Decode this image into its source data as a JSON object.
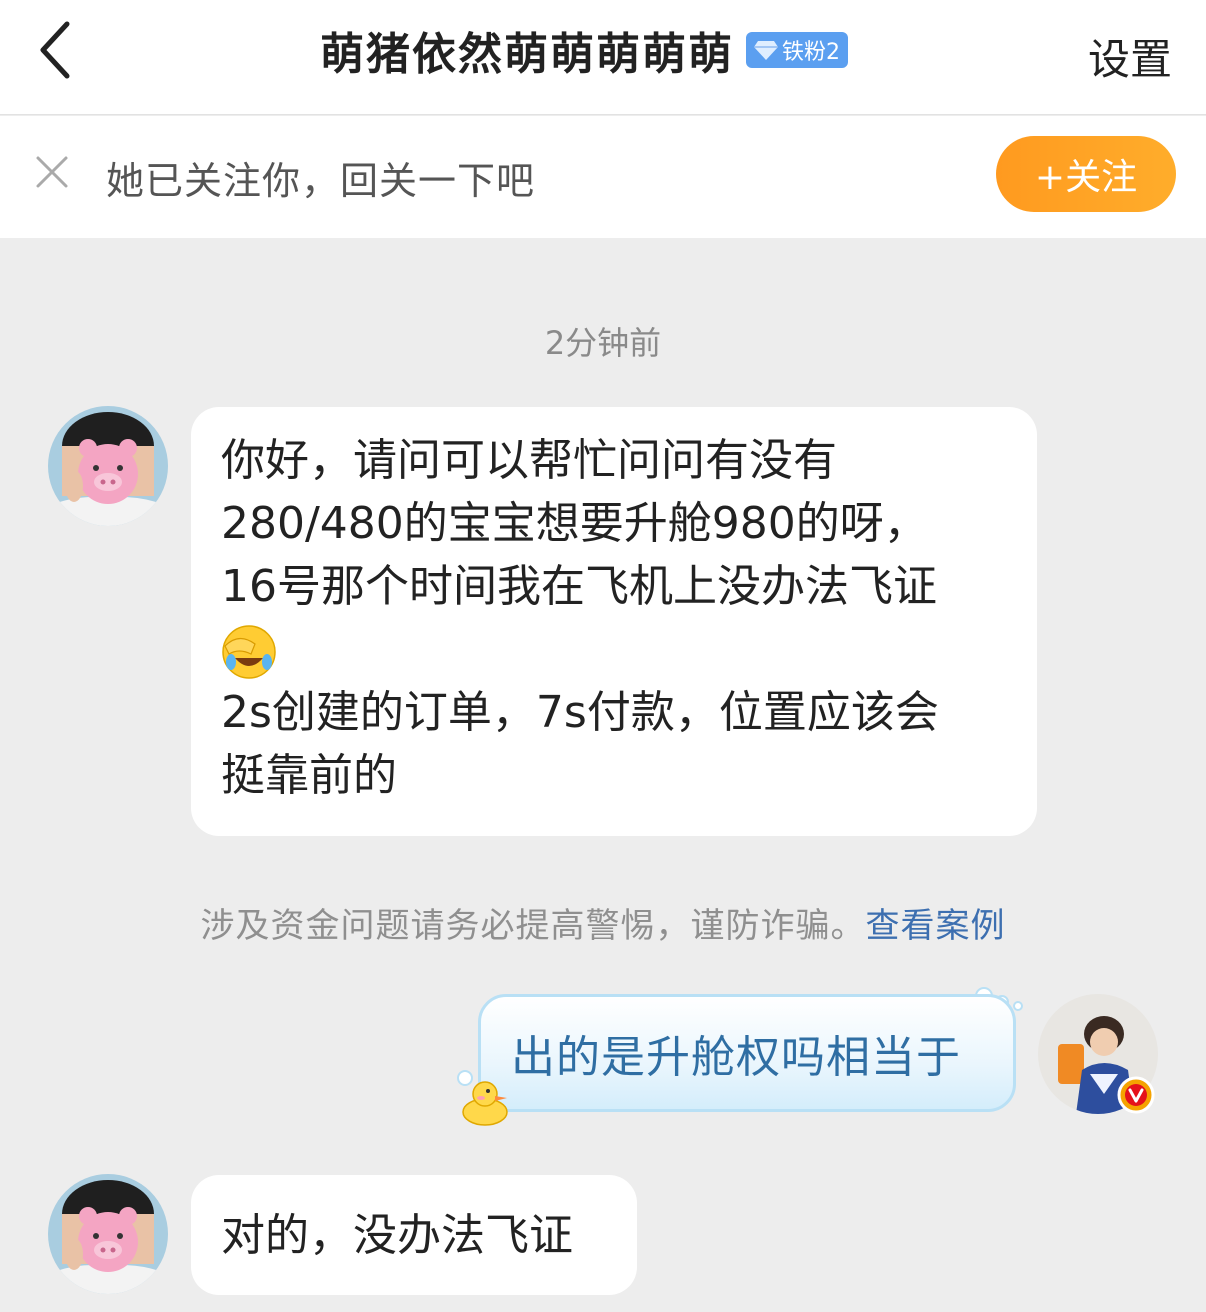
{
  "header": {
    "title": "萌猪依然萌萌萌萌萌",
    "fan_badge": "铁粉2",
    "settings_label": "设置"
  },
  "follow_bar": {
    "message": "她已关注你，回关一下吧",
    "follow_button": "+关注"
  },
  "chat": {
    "timestamp": "2分钟前",
    "messages": [
      {
        "sender": "other",
        "lines": [
          "你好，请问可以帮忙问问有没有",
          " 280/480的宝宝想要升舱980的呀，",
          "16号那个时间我在飞机上没办法飞证",
          "2s创建的订单，7s付款，位置应该会",
          "挺靠前的"
        ]
      },
      {
        "sender": "me",
        "text": "出的是升舱权吗相当于"
      },
      {
        "sender": "other",
        "text": "对的，没办法飞证"
      }
    ],
    "warning_text": "涉及资金问题请务必提高警惕，谨防诈骗。",
    "warning_link": "查看案例"
  },
  "colors": {
    "follow_button": "#ff9a1f",
    "badge": "#5b9ff0",
    "link": "#3d6fb0",
    "my_bubble_text": "#2f6ea3",
    "verified_badge": "#f5a300"
  }
}
